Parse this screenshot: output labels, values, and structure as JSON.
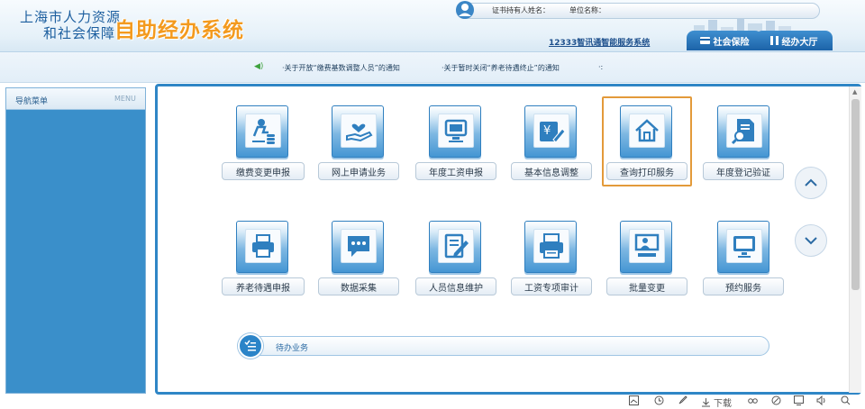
{
  "header": {
    "org_line1": "上海市人力资源",
    "org_line2": "和社会保障",
    "system_title": "自助经办系统",
    "holder_label": "证书持有人姓名：",
    "unit_label": "单位名称：",
    "link_12333": "12333智讯通智能服务系统",
    "tabs": [
      {
        "label": "社会保险",
        "icon": "card-icon"
      },
      {
        "label": "经办大厅",
        "icon": "pause-icon"
      }
    ]
  },
  "notice": {
    "item1": "·关于开放“缴费基数调整人员”的通知",
    "item2": "·关于暂时关闭“养老待遇终止”的通知",
    "end": "·:"
  },
  "sidebar": {
    "title": "导航菜单",
    "menu_label": "MENU"
  },
  "services": [
    {
      "label": "缴费变更申报",
      "icon": "person-coins-icon"
    },
    {
      "label": "网上申请业务",
      "icon": "hand-heart-icon"
    },
    {
      "label": "年度工资申报",
      "icon": "monitor-icon"
    },
    {
      "label": "基本信息调整",
      "icon": "yuan-card-icon"
    },
    {
      "label": "查询打印服务",
      "icon": "house-icon"
    },
    {
      "label": "年度登记验证",
      "icon": "document-search-icon"
    },
    {
      "label": "养老待遇申报",
      "icon": "printer-icon"
    },
    {
      "label": "数据采集",
      "icon": "chat-bubble-icon"
    },
    {
      "label": "人员信息维护",
      "icon": "edit-document-icon"
    },
    {
      "label": "工资专项审计",
      "icon": "print-fax-icon"
    },
    {
      "label": "批量变更",
      "icon": "presenter-icon"
    },
    {
      "label": "预约服务",
      "icon": "screen-icon"
    }
  ],
  "todo": {
    "label": "待办业务"
  },
  "toolbar": {
    "download_label": "下载"
  },
  "colors": {
    "brand_blue": "#2f86c6",
    "title_orange": "#f39a1e",
    "highlight": "#e39a3a"
  }
}
